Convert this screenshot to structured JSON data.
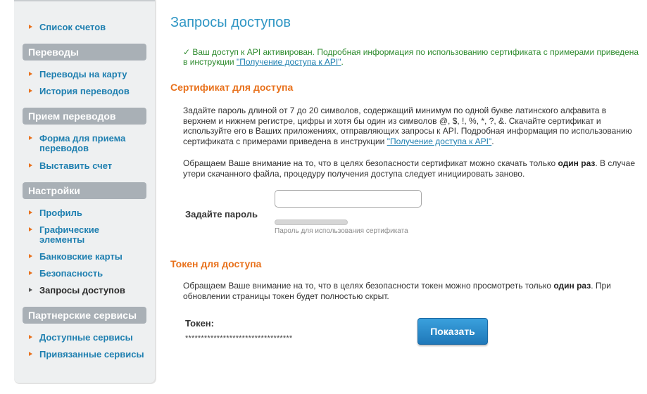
{
  "sidebar": {
    "top_items": [
      {
        "label": "Список счетов"
      }
    ],
    "sections": [
      {
        "title": "Переводы",
        "items": [
          {
            "label": "Переводы на карту"
          },
          {
            "label": "История переводов"
          }
        ]
      },
      {
        "title": "Прием переводов",
        "items": [
          {
            "label": "Форма для приема переводов"
          },
          {
            "label": "Выставить счет"
          }
        ]
      },
      {
        "title": "Настройки",
        "items": [
          {
            "label": "Профиль"
          },
          {
            "label": "Графические элементы"
          },
          {
            "label": "Банковские карты"
          },
          {
            "label": "Безопасность"
          },
          {
            "label": "Запросы доступов"
          }
        ]
      },
      {
        "title": "Партнерские сервисы",
        "items": [
          {
            "label": "Доступные сервисы"
          },
          {
            "label": "Привязанные сервисы"
          }
        ]
      }
    ]
  },
  "main": {
    "title": "Запросы доступов",
    "notice": {
      "check": "✓",
      "text": "Ваш доступ к API активирован. Подробная информация по использованию сертификата с примерами приведена в инструкции",
      "link": "\"Получение доступа к API\"",
      "end": "."
    },
    "certificate": {
      "title": "Сертификат для доступа",
      "para1_text": "Задайте пароль длиной от 7 до 20 символов, содержащий минимум по одной букве латинского алфавита в верхнем и нижнем регистре, цифры и хотя бы один из символов @, $, !, %, *, ?, &. Скачайте сертификат и используйте его в Ваших приложениях, отправляющих запросы к API. Подробная информация по использованию сертификата с примерами приведена в инструкции",
      "para1_link": "\"Получение доступа к API\"",
      "para1_end": ".",
      "para2_before": "Обращаем Ваше внимание на то, что в целях безопасности сертификат можно скачать только",
      "para2_bold": "один раз",
      "para2_after": ". В случае утери скачанного файла, процедуру получения доступа следует инициировать заново.",
      "password_label": "Задайте пароль",
      "password_value": "",
      "password_hint": "Пароль для использования сертификата"
    },
    "token": {
      "title": "Токен для доступа",
      "para_before": "Обращаем Ваше внимание на то, что в целях безопасности токен можно просмотреть только",
      "para_bold": "один раз",
      "para_after": ". При обновлении страницы токен будет полностью скрыт.",
      "label": "Токен:",
      "value": "**********************************",
      "show_button": "Показать"
    }
  },
  "colors": {
    "link": "#1e7fb0",
    "accent_orange": "#e8711c",
    "title_blue": "#2f96c4",
    "success_green": "#2d8a2d",
    "section_header_bg": "#a9b0b6",
    "button_blue": "#2a8acb"
  },
  "icons": {
    "nav_bullet": "triangle-right-icon"
  }
}
